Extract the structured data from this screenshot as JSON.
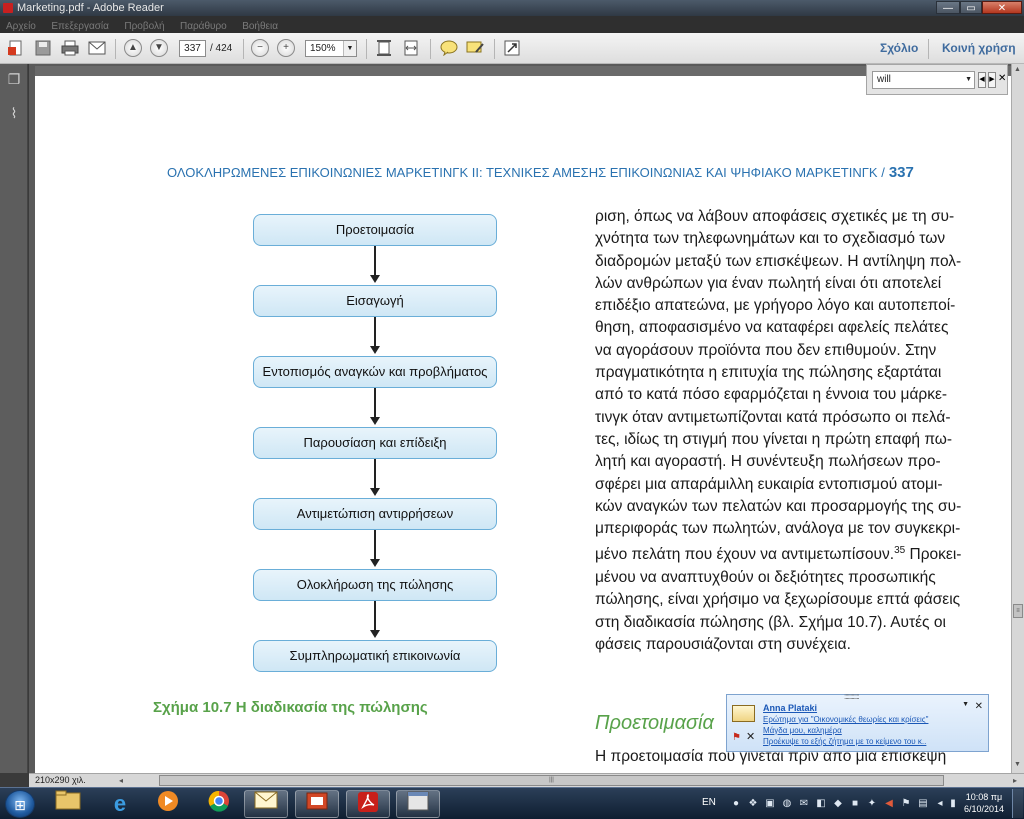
{
  "window": {
    "title": "Marketing.pdf - Adobe Reader",
    "controls": {
      "minimize": "—",
      "maximize": "▭",
      "close": "✕"
    }
  },
  "menu": [
    "Αρχείο",
    "Επεξεργασία",
    "Προβολή",
    "Παράθυρο",
    "Βοήθεια"
  ],
  "toolbar": {
    "current_page": "337",
    "total_pages": "/ 424",
    "zoom": "150%",
    "comment_label": "Σχόλιο",
    "share_label": "Κοινή χρήση",
    "icons": [
      "create-icon",
      "save-icon",
      "print-icon",
      "email-icon",
      "prev-page-icon",
      "next-page-icon",
      "zoom-out-icon",
      "zoom-in-icon",
      "fit-page-icon",
      "fit-width-icon",
      "sticky-note-icon",
      "highlight-icon",
      "expand-icon"
    ]
  },
  "find": {
    "query": "will"
  },
  "document": {
    "running_head": "ΟΛΟΚΛΗΡΩΜΕΝΕΣ ΕΠΙΚΟΙΝΩΝΙΕΣ ΜΑΡΚΕΤΙΝΓΚ ΙΙ: ΤΕΧΝΙΚΕΣ ΑΜΕΣΗΣ ΕΠΙΚΟΙΝΩΝΙΑΣ ΚΑΙ ΨΗΦΙΑΚΟ ΜΑΡΚΕΤΙΝΓΚ  /",
    "page_number": "337",
    "flow_steps": [
      "Προετοιμασία",
      "Εισαγωγή",
      "Εντοπισμός αναγκών και προβλήματος",
      "Παρουσίαση και επίδειξη",
      "Αντιμετώπιση αντιρρήσεων",
      "Ολοκλήρωση της πώλησης",
      "Συμπληρωματική επικοινωνία"
    ],
    "figure_caption": "Σχήμα 10.7  Η διαδικασία της πώλησης",
    "body_lines": [
      "ριση, όπως να λάβουν αποφάσεις σχετικές με τη συ-",
      "χνότητα των τηλεφωνημάτων και το σχεδιασμό των",
      "διαδρομών μεταξύ των επισκέψεων. Η αντίληψη πολ-",
      "λών ανθρώπων για έναν πωλητή είναι ότι αποτελεί",
      "επιδέξιο απατεώνα, με γρήγορο λόγο και αυτοπεποί-",
      "θηση, αποφασισμένο να καταφέρει αφελείς πελάτες",
      "να αγοράσουν προϊόντα που δεν επιθυμούν. Στην",
      "πραγματικότητα η επιτυχία της πώλησης εξαρτάται",
      "από το κατά πόσο εφαρμόζεται η έννοια του μάρκε-",
      "τινγκ όταν αντιμετωπίζονται κατά πρόσωπο οι πελά-",
      "τες, ιδίως τη στιγμή που γίνεται η πρώτη επαφή πω-",
      "λητή και αγοραστή. Η συνέντευξη πωλήσεων προ-",
      "σφέρει μια απαράμιλλη ευκαιρία εντοπισμού ατομι-",
      "κών αναγκών των πελατών και προσαρμογής της συ-",
      "μπεριφοράς των πωλητών, ανάλογα με τον συγκεκρι-",
      "μένο πελάτη που έχουν να αντιμετωπίσουν.",
      "μένου να αναπτυχθούν οι δεξιότητες προσωπικής",
      "πώλησης, είναι χρήσιμο να ξεχωρίσουμε επτά φάσεις",
      "στη διαδικασία πώλησης (βλ. Σχήμα 10.7). Αυτές οι",
      "φάσεις παρουσιάζονται στη συνέχεια."
    ],
    "footnote_ref": "35",
    "line16_tail": " Προκει-",
    "subheading": "Προετοιμασία",
    "last_line": "Η προετοιμασία που γίνεται πριν από μια επίσκεψη"
  },
  "status": {
    "page_size": "210x290 χιλ."
  },
  "notification": {
    "sender": "Anna Plataki",
    "line1": "Ερώτημα για \"Οικονομικές θεωρίες και κρίσεις\"",
    "line2": "Μάγδα μου, καλημέρα",
    "line3": "Προέκυψε το εξής ζήτημα με το κείμενο του κ.."
  },
  "taskbar": {
    "apps": [
      "explorer-icon",
      "internet-explorer-icon",
      "media-player-icon",
      "chrome-icon",
      "outlook-icon",
      "presentation-icon",
      "adobe-reader-icon",
      "window-icon"
    ],
    "language": "EN",
    "time": "10:08 πμ",
    "date": "6/10/2014"
  },
  "colors": {
    "heading_blue": "#2a72b0",
    "caption_green": "#58a24a",
    "flow_box_border": "#6aaed8",
    "link_blue": "#1b58b7"
  }
}
